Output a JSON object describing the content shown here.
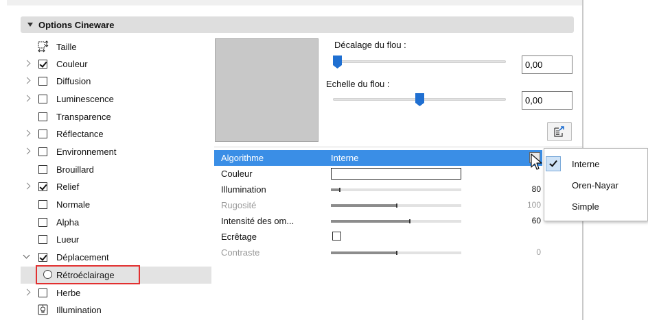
{
  "header": {
    "title": "Options Cineware"
  },
  "tree": {
    "items": [
      {
        "label": "Taille",
        "kind": "size-icon"
      },
      {
        "label": "Couleur",
        "expand": "right",
        "checked": true
      },
      {
        "label": "Diffusion",
        "expand": "right",
        "checked": false
      },
      {
        "label": "Luminescence",
        "expand": "right",
        "checked": false
      },
      {
        "label": "Transparence",
        "expand": "none",
        "checked": false
      },
      {
        "label": "Réflectance",
        "expand": "right",
        "checked": false
      },
      {
        "label": "Environnement",
        "expand": "right",
        "checked": false
      },
      {
        "label": "Brouillard",
        "expand": "none",
        "checked": false
      },
      {
        "label": "Relief",
        "expand": "right",
        "checked": true
      },
      {
        "label": "Normale",
        "expand": "none",
        "checked": false
      },
      {
        "label": "Alpha",
        "expand": "none",
        "checked": false
      },
      {
        "label": "Lueur",
        "expand": "none",
        "checked": false
      },
      {
        "label": "Déplacement",
        "expand": "down",
        "checked": true
      },
      {
        "label": "Rétroéclairage",
        "kind": "radio"
      },
      {
        "label": "Herbe",
        "expand": "right",
        "checked": false
      },
      {
        "label": "Illumination",
        "kind": "light-icon"
      }
    ]
  },
  "blur": {
    "offset_label": "Décalage du flou :",
    "offset_value": "0,00",
    "scale_label": "Echelle du flou :",
    "scale_value": "0,00"
  },
  "props": {
    "rows": [
      {
        "name": "Algorithme",
        "value": "Interne",
        "type": "dropdown"
      },
      {
        "name": "Couleur",
        "type": "color"
      },
      {
        "name": "Illumination",
        "type": "slider",
        "number": "80"
      },
      {
        "name": "Rugosité",
        "type": "slider",
        "number": "100",
        "disabled": true
      },
      {
        "name": "Intensité des om...",
        "type": "slider",
        "number": "60"
      },
      {
        "name": "Ecrêtage",
        "type": "checkbox"
      },
      {
        "name": "Contraste",
        "type": "slider",
        "number": "0",
        "disabled": true
      }
    ]
  },
  "menu": {
    "items": [
      {
        "label": "Interne",
        "checked": true
      },
      {
        "label": "Oren-Nayar",
        "checked": false
      },
      {
        "label": "Simple",
        "checked": false
      }
    ]
  },
  "colors": {
    "selection": "#3a8ee6",
    "thumb": "#1f6fd1",
    "highlight_box": "#e23030"
  }
}
